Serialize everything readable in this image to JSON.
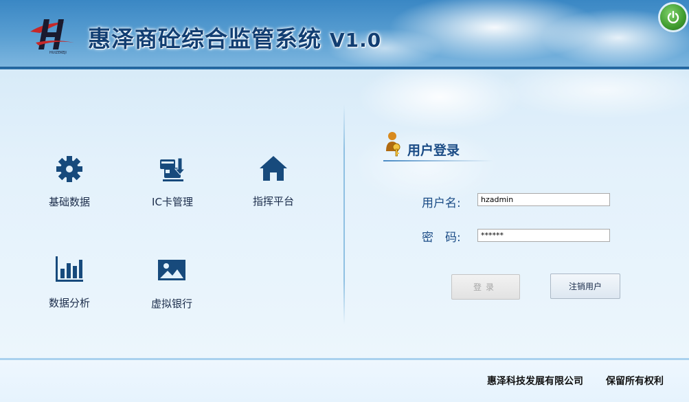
{
  "header": {
    "title": "惠泽商砼综合监管系统",
    "version": "V1.0",
    "logo_text": "HUIZEKEJI",
    "power_icon": "power-icon",
    "power_color": "#3f9b2e"
  },
  "modules": [
    {
      "label": "基础数据",
      "icon": "gear-icon"
    },
    {
      "label": "IC卡管理",
      "icon": "ic-card-icon"
    },
    {
      "label": "指挥平台",
      "icon": "home-icon"
    },
    {
      "label": "数据分析",
      "icon": "bar-chart-icon"
    },
    {
      "label": "虚拟银行",
      "icon": "image-icon"
    }
  ],
  "login": {
    "title": "用户登录",
    "title_icon": "user-key-icon",
    "username_label": "用户名:",
    "username_value": "hzadmin",
    "password_label": "密　码:",
    "password_value": "******",
    "login_button": "登录",
    "logout_button": "注销用户"
  },
  "footer": {
    "company": "惠泽科技发展有限公司",
    "rights": "保留所有权利"
  },
  "colors": {
    "header_blue": "#3a87c4",
    "title_text": "#123e72",
    "icon_blue": "#174a7c",
    "label_blue": "#1b4c86"
  }
}
